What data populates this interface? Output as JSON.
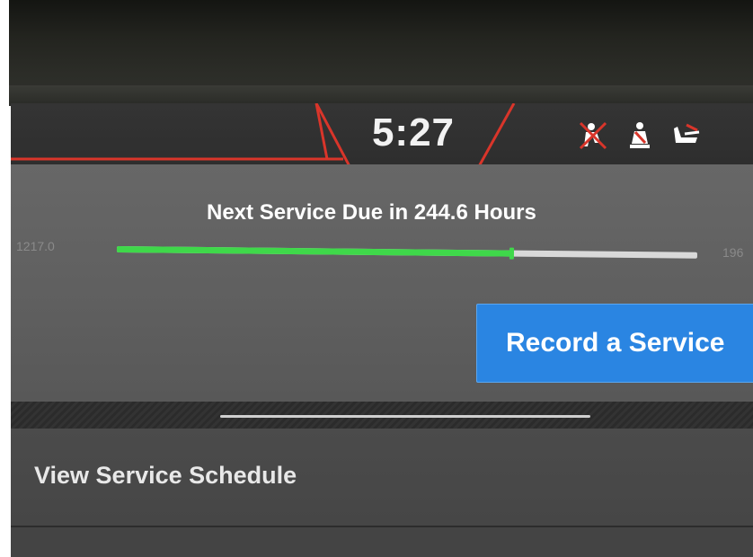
{
  "status_bar": {
    "clock": "5:27",
    "icons": [
      "seatbelt-warning-icon",
      "seatbelt-operator-icon",
      "seat-adjust-icon"
    ],
    "accent_color": "#d9352a"
  },
  "service": {
    "label": "Next Service Due in 244.6 Hours",
    "range_min": "1217.0",
    "range_max": "196",
    "progress_fraction": 0.68,
    "progress_color": "#3fd84a"
  },
  "actions": {
    "record_service_label": "Record a Service",
    "button_color": "#2a85e2"
  },
  "menu": {
    "items": [
      {
        "label": "View Service Schedule"
      }
    ]
  }
}
